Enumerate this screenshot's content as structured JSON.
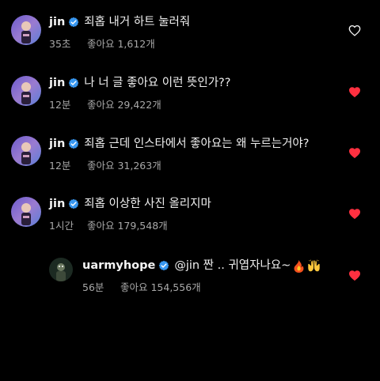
{
  "comments": [
    {
      "username": "jin",
      "text": "죄홉 내거 하트 눌러줘",
      "time": "35초",
      "likes": "좋아요 1,612개",
      "liked": false,
      "avatar_icon": "jin-avatar-icon"
    },
    {
      "username": "jin",
      "text": "나 너 글 좋아요 이런 뜻인가??",
      "time": "12분",
      "likes": "좋아요 29,422개",
      "liked": true,
      "avatar_icon": "jin-avatar-icon"
    },
    {
      "username": "jin",
      "text": "죄홉 근데 인스타에서 좋아요는 왜 누르는거야?",
      "time": "12분",
      "likes": "좋아요 31,263개",
      "liked": true,
      "avatar_icon": "jin-avatar-icon"
    },
    {
      "username": "jin",
      "text": "죄홉 이상한 사진 올리지마",
      "time": "1시간",
      "likes": "좋아요 179,548개",
      "liked": true,
      "avatar_icon": "jin-avatar-icon"
    }
  ],
  "reply": {
    "username": "uarmyhope",
    "text": "@jin 짠 .. 귀엽자나요~",
    "emojis": [
      "fire-emoji",
      "raised-hands-emoji"
    ],
    "time": "56분",
    "likes": "좋아요 154,556개",
    "liked": true,
    "avatar_icon": "hope-avatar-icon"
  },
  "colors": {
    "background": "#000000",
    "text": "#f5f5f5",
    "meta": "#a8a8a8",
    "verified": "#3897f0",
    "heart_liked": "#ff3040",
    "heart_outline": "#f5f5f5"
  }
}
